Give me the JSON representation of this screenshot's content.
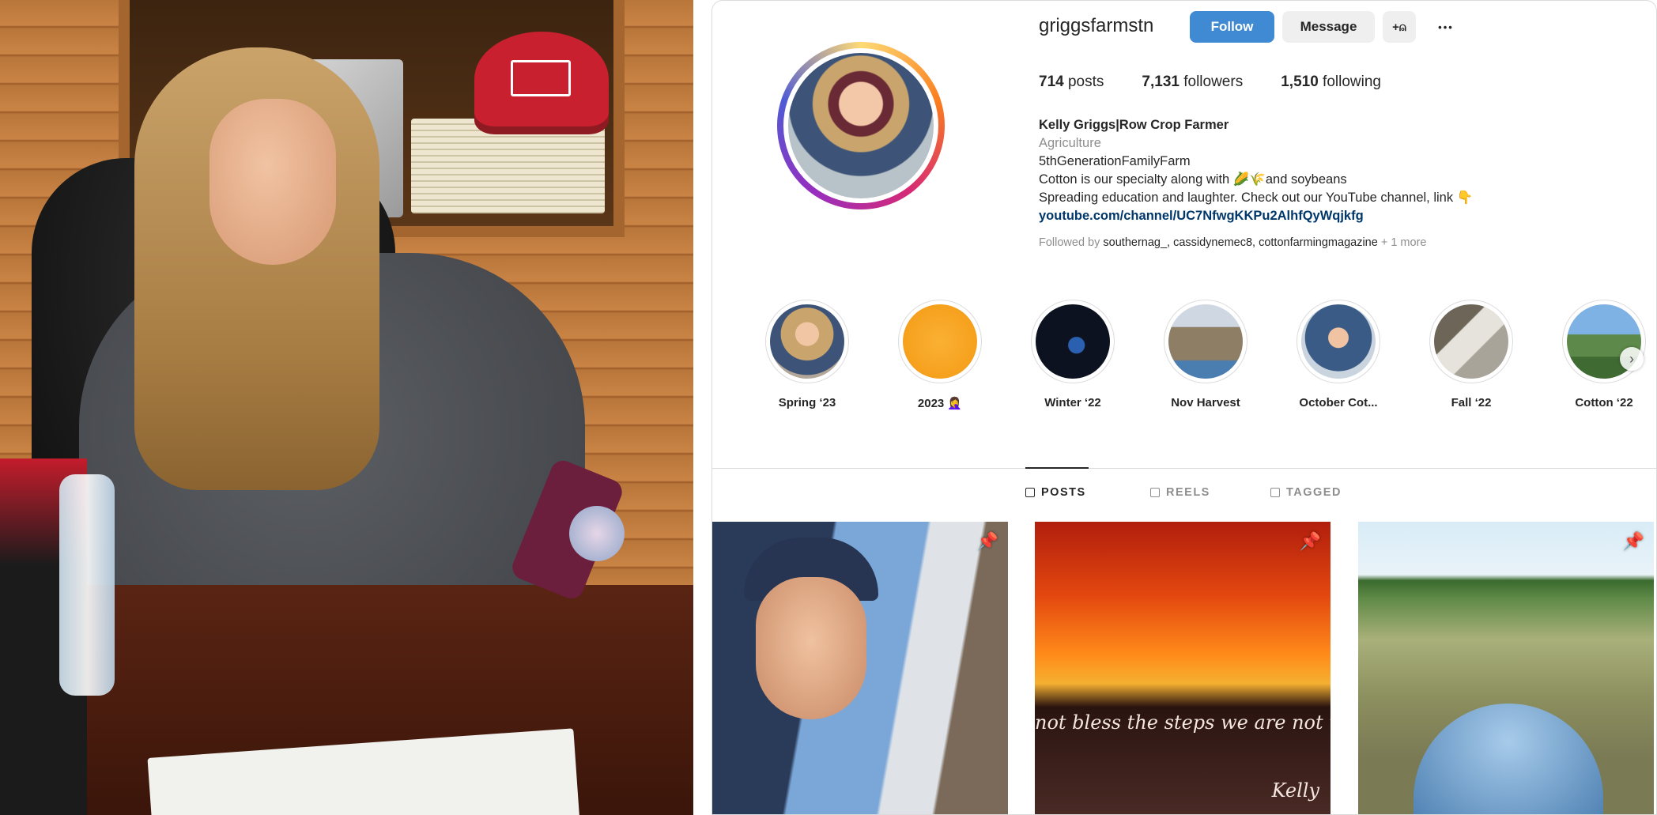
{
  "profile": {
    "username": "griggsfarmstn",
    "follow_label": "Follow",
    "message_label": "Message",
    "add_user_glyph": "+⍝",
    "more_glyph": "•••",
    "stats": {
      "posts_count": "714",
      "posts_label": "posts",
      "followers_count": "7,131",
      "followers_label": "followers",
      "following_count": "1,510",
      "following_label": "following"
    },
    "bio": {
      "name": "Kelly Griggs|Row Crop Farmer",
      "category": "Agriculture",
      "line1": "5thGenerationFamilyFarm",
      "line2": "Cotton is our specialty along with 🌽🌾and soybeans",
      "line3": "Spreading education and laughter. Check out our YouTube channel, link 👇",
      "link": "youtube.com/channel/UC7NfwgKKPu2AlhfQyWqjkfg"
    },
    "followed_by": {
      "prefix": "Followed by",
      "users": "southernag_, cassidynemec8, cottonfarmingmagazine",
      "more": "+ 1 more"
    }
  },
  "highlights": [
    {
      "label": "Spring ‘23",
      "color": "#c9a56d"
    },
    {
      "label": "2023 🤦‍♀️",
      "color": "#f7a21b"
    },
    {
      "label": "Winter ‘22",
      "color": "#0c1220"
    },
    {
      "label": "Nov Harvest",
      "color": "#8e7e66"
    },
    {
      "label": "October Cot...",
      "color": "#3a5b86"
    },
    {
      "label": "Fall ‘22",
      "color": "#a9a49a"
    },
    {
      "label": "Cotton ‘22",
      "color": "#5d8a4a"
    }
  ],
  "highlights_next_glyph": "›",
  "tabs": {
    "posts": "POSTS",
    "reels": "REELS",
    "tagged": "TAGGED"
  },
  "posts": {
    "post2_caption": "not bless the steps we are not willing",
    "post2_signature": "Kelly",
    "pin_glyph": "📌"
  },
  "colors": {
    "follow_button": "#3f8ad2",
    "link": "#00376b",
    "muted": "#8e8e8e"
  }
}
